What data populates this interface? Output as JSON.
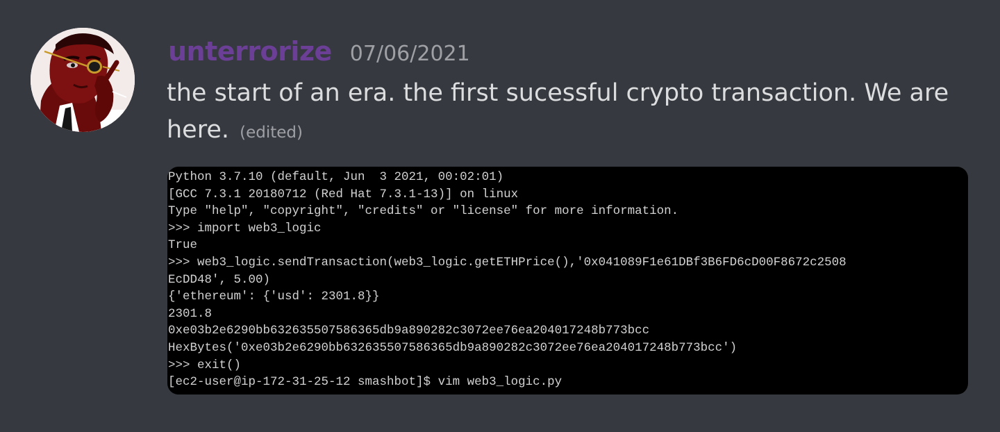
{
  "message": {
    "author": {
      "username": "unterrorize",
      "username_color": "#6b3f96",
      "avatar": "avatar-image"
    },
    "timestamp": "07/06/2021",
    "content_lines": [
      "the start of an era. the first sucessful crypto transaction. We are",
      "here."
    ],
    "edited_label": "(edited)"
  },
  "attachment": {
    "type": "terminal-screenshot",
    "lines": [
      "Python 3.7.10 (default, Jun  3 2021, 00:02:01)",
      "[GCC 7.3.1 20180712 (Red Hat 7.3.1-13)] on linux",
      "Type \"help\", \"copyright\", \"credits\" or \"license\" for more information.",
      ">>> import web3_logic",
      "True",
      ">>> web3_logic.sendTransaction(web3_logic.getETHPrice(),'0x041089F1e61DBf3B6FD6cD00F8672c2508",
      "EcDD48', 5.00)",
      "{'ethereum': {'usd': 2301.8}}",
      "2301.8",
      "0xe03b2e6290bb632635507586365db9a890282c3072ee76ea204017248b773bcc",
      "HexBytes('0xe03b2e6290bb632635507586365db9a890282c3072ee76ea204017248b773bcc')",
      ">>> exit()",
      "[ec2-user@ip-172-31-25-12 smashbot]$ vim web3_logic.py"
    ]
  },
  "colors": {
    "background": "#36393f",
    "message_text": "#dcddde",
    "muted_text": "#9ea0a6",
    "terminal_background": "#000000",
    "terminal_text": "#d2d2d2"
  }
}
